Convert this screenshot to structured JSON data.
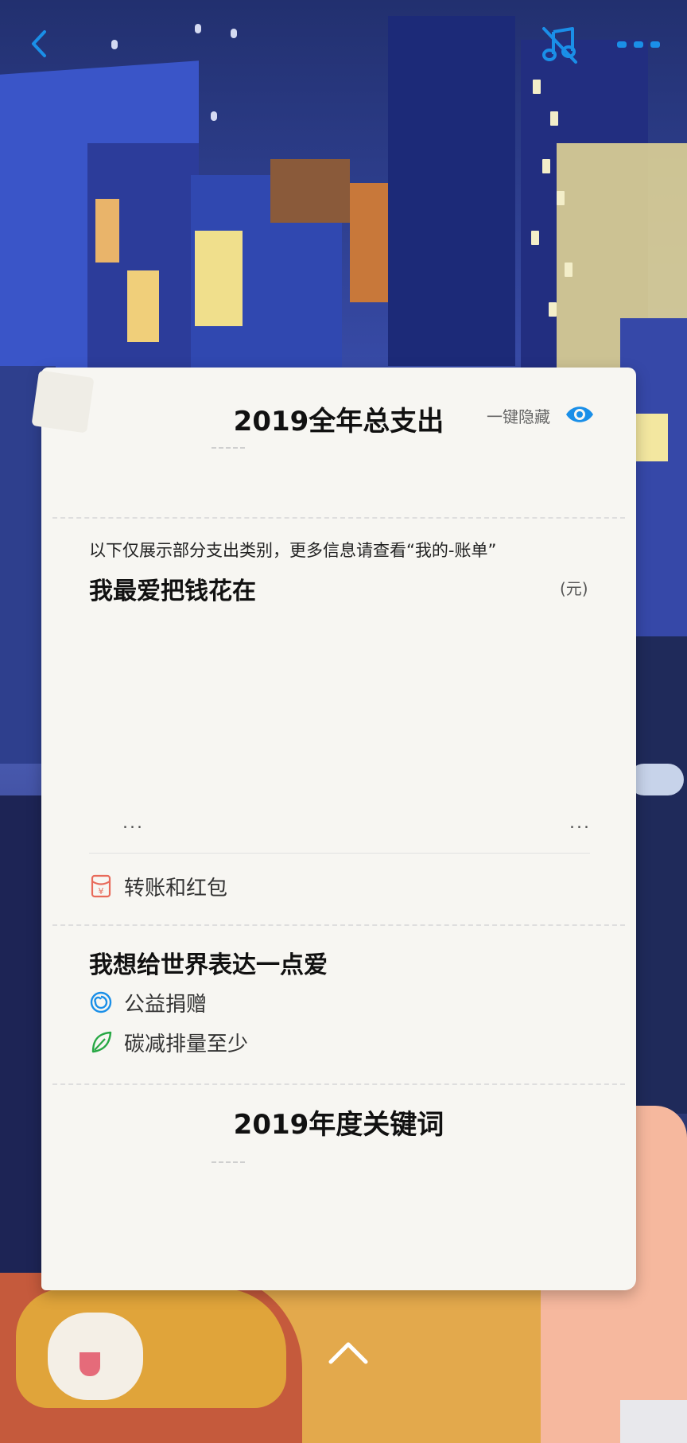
{
  "header": {
    "back_icon": "chevron-left-icon",
    "music_icon": "music-note-icon",
    "more_icon": "more-dots-icon",
    "accent_color": "#1a8fe8"
  },
  "summary": {
    "title": "2019全年总支出",
    "hide_label": "一键隐藏",
    "hide_icon": "eye-icon"
  },
  "spending": {
    "note": "以下仅展示部分支出类别，更多信息请查看“我的-账单”",
    "heading": "我最爱把钱花在",
    "unit": "(元)",
    "ellipsis_left": "...",
    "ellipsis_right": "...",
    "category": {
      "label": "转账和红包",
      "icon": "red-envelope-icon",
      "color": "#e86a5a"
    }
  },
  "love": {
    "heading": "我想给世界表达一点爱",
    "items": [
      {
        "label": "公益捐赠",
        "icon": "charity-swirl-icon",
        "color": "#1a8fe8"
      },
      {
        "label": "碳减排量至少",
        "icon": "leaf-icon",
        "color": "#27a844"
      }
    ]
  },
  "keywords": {
    "title": "2019年度关键词"
  },
  "footer": {
    "up_icon": "chevron-up-icon"
  }
}
